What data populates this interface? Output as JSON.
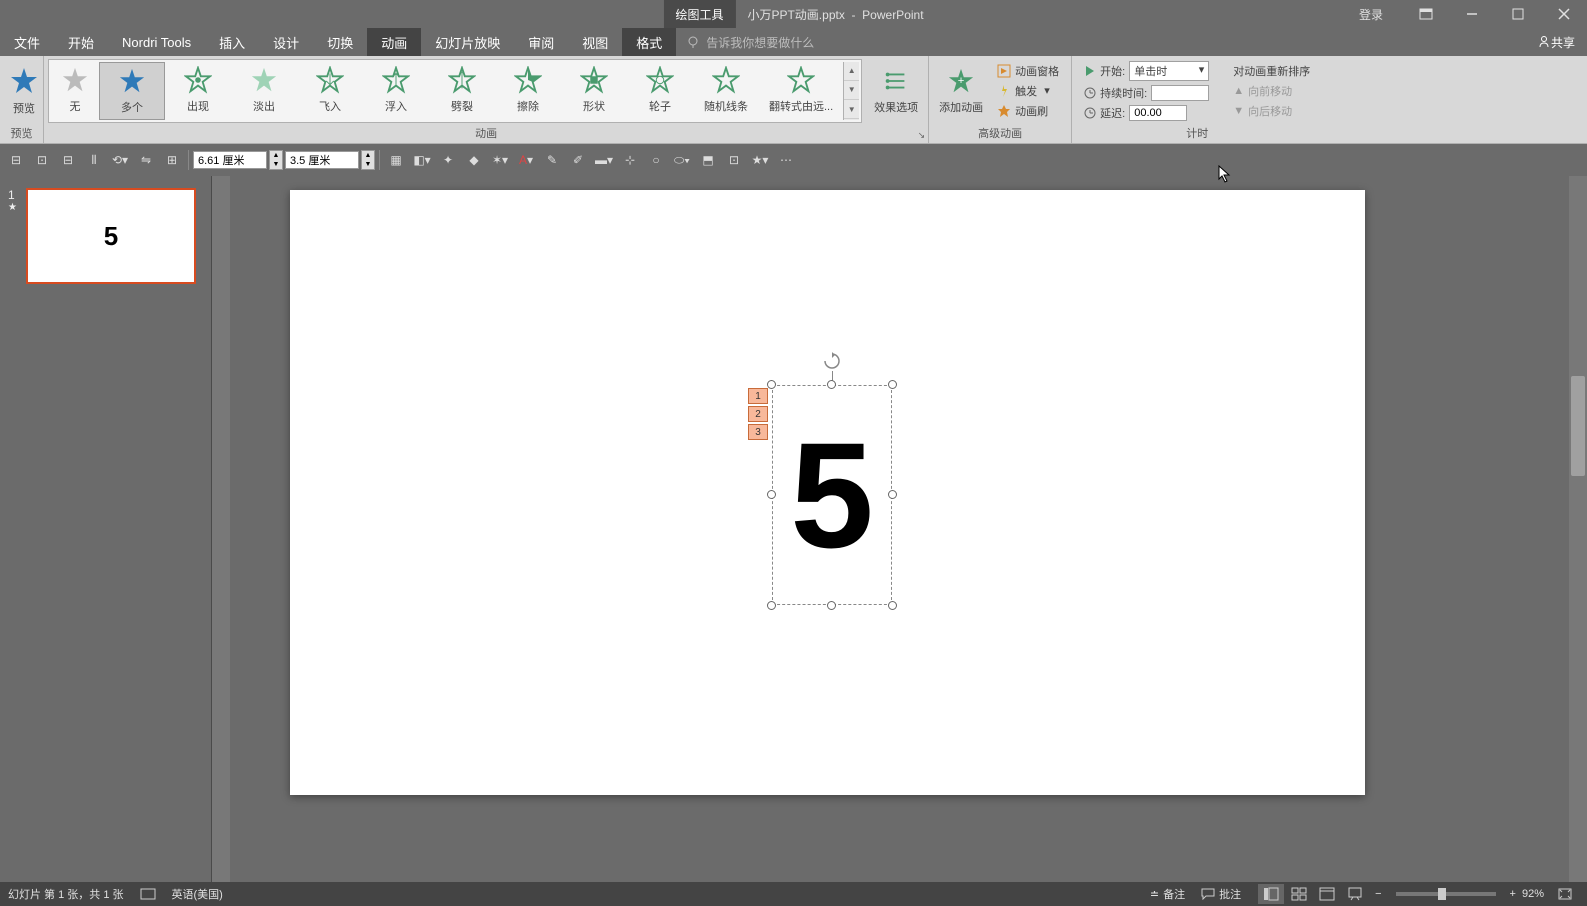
{
  "title": {
    "tool_context": "绘图工具",
    "filename": "小万PPT动画.pptx",
    "app": "PowerPoint",
    "login": "登录"
  },
  "menu": {
    "file": "文件",
    "home": "开始",
    "nordri": "Nordri Tools",
    "insert": "插入",
    "design": "设计",
    "transition": "切换",
    "animation": "动画",
    "slideshow": "幻灯片放映",
    "review": "审阅",
    "view": "视图",
    "format": "格式",
    "tellme": "告诉我你想要做什么",
    "share": "共享"
  },
  "ribbon": {
    "preview": {
      "label": "预览",
      "group": "预览"
    },
    "anim_gallery": {
      "none": "无",
      "multiple": "多个",
      "appear": "出现",
      "fade": "淡出",
      "flyin": "飞入",
      "floatin": "浮入",
      "split": "劈裂",
      "wipe": "擦除",
      "shape": "形状",
      "wheel": "轮子",
      "random": "随机线条",
      "grow": "翻转式由远...",
      "group_label": "动画"
    },
    "effect_opts": "效果选项",
    "add_anim": "添加动画",
    "anim_pane": "动画窗格",
    "trigger": "触发",
    "anim_painter": "动画刷",
    "adv_group": "高级动画",
    "timing": {
      "start_lbl": "开始:",
      "start_val": "单击时",
      "dur_lbl": "持续时间:",
      "dur_val": "",
      "delay_lbl": "延迟:",
      "delay_val": "00.00",
      "reorder": "对动画重新排序",
      "move_earlier": "向前移动",
      "move_later": "向后移动",
      "group": "计时"
    }
  },
  "sec_toolbar": {
    "width": "6.61 厘米",
    "height": "3.5 厘米"
  },
  "slide_panel": {
    "num": "1",
    "thumb_text": "5"
  },
  "canvas": {
    "main_text": "5",
    "tags": [
      "1",
      "2",
      "3"
    ]
  },
  "status": {
    "slide_info": "幻灯片 第 1 张，共 1 张",
    "lang": "英语(美国)",
    "notes": "备注",
    "comments": "批注",
    "zoom": "92%"
  }
}
